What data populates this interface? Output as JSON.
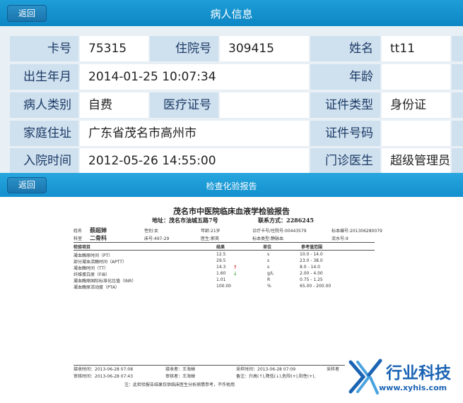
{
  "header": {
    "back_label": "返回",
    "title": "病人信息"
  },
  "patient": {
    "card_no_label": "卡号",
    "card_no": "75315",
    "inpatient_no_label": "住院号",
    "inpatient_no": "309415",
    "name_label": "姓名",
    "name": "tt11",
    "birth_label": "出生年月",
    "birth": "2014-01-25 10:07:34",
    "age_label": "年龄",
    "age": "",
    "category_label": "病人类别",
    "category": "自费",
    "medical_card_label": "医疗证号",
    "medical_card": "",
    "id_type_label": "证件类型",
    "id_type": "身份证",
    "address_label": "家庭住址",
    "address": "广东省茂名市高州市",
    "id_no_label": "证件号码",
    "id_no": "",
    "admit_label": "入院时间",
    "admit": "2012-05-26 14:55:00",
    "doctor_label": "门诊医生",
    "doctor": "超级管理员"
  },
  "section": {
    "back_label": "返回",
    "title": "检查化验报告"
  },
  "report": {
    "title": "茂名市中医院临床血液学检验报告",
    "address": "地址：茂名市油城五路7号",
    "contact": "联系方式：2286245",
    "name_label": "姓名",
    "name": "蔡超婵",
    "sex": "性别:女",
    "age": "年龄:21岁",
    "diag_no": "诊疗卡号/住院号:00443579",
    "specimen_no": "标本编号:201306280079",
    "dept_label": "科室",
    "dept": "二骨科",
    "bed": "床号:497-29",
    "doctor": "医生:郭英",
    "specimen_type": "标本类型:静脉血",
    "serial": "流水号:9",
    "col_item": "检验项目",
    "col_result": "结果",
    "col_unit": "单位",
    "col_ref": "参考值范围",
    "rows": [
      {
        "item": "凝血酶原时间（PT）",
        "result": "12.5",
        "flag": "",
        "unit": "s",
        "ref": "10.0 - 14.0"
      },
      {
        "item": "部分凝血活酶时间（APTT）",
        "result": "29.5",
        "flag": "",
        "unit": "s",
        "ref": "23.0 - 38.0"
      },
      {
        "item": "凝血酶时间（TT）",
        "result": "14.3",
        "flag": "↑",
        "unit": "s",
        "ref": "8.0 - 14.0"
      },
      {
        "item": "纤维蛋白原（FIB）",
        "result": "1.60",
        "flag": "↓",
        "unit": "g/L",
        "ref": "2.00 - 4.00"
      },
      {
        "item": "凝血酶原国际标准化比值（INR）",
        "result": "1.01",
        "flag": "",
        "unit": "R",
        "ref": "0.75 - 1.25"
      },
      {
        "item": "凝血酶原活动度（PTA）",
        "result": "100.00",
        "flag": "",
        "unit": "%",
        "ref": "65.00 - 200.00"
      }
    ],
    "receive_time": "接收时间：2013-06-28  07:08",
    "receiver": "接收者：王海婵",
    "sample_time": "采样时间：2013-06-28  07:09",
    "sampler": "采样者",
    "audit_time": "审核时间：2013-06-28  07:43",
    "auditor": "审核者：王海婵",
    "remark": "备注：升高(↑),降低(↓),危险(+),阳性(+),",
    "footnote": "注：此检验报告结果仅供临床医生分析病情参考，不作他用"
  },
  "watermark": {
    "brand": "行业科技",
    "url": "www.xyhis.com"
  },
  "colors": {
    "bar": "#1e9ed8",
    "label_bg": "#cfe0ee",
    "label_text": "#1b3a66",
    "brand": "#1b63b3"
  }
}
